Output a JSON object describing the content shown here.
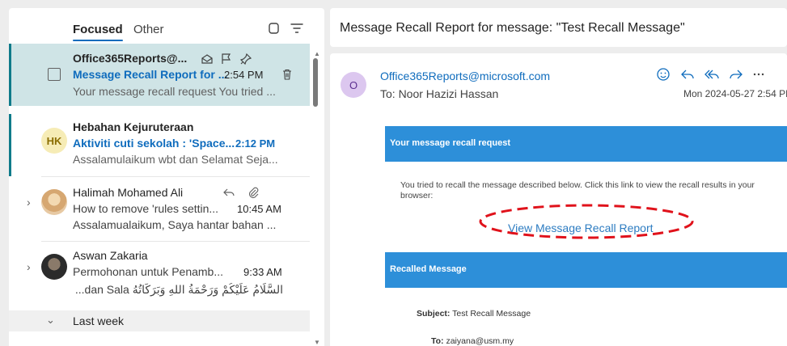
{
  "tabs": {
    "focused": "Focused",
    "other": "Other"
  },
  "mails": [
    {
      "sender": "Office365Reports@...",
      "subject": "Message Recall Report for ...",
      "time": "2:54 PM",
      "preview": "Your message recall request You tried ..."
    },
    {
      "initials": "HK",
      "sender": "Hebahan Kejuruteraan",
      "subject": "Aktiviti cuti sekolah : 'Space...",
      "time": "2:12 PM",
      "preview": "Assalamulaikum wbt dan Selamat Seja..."
    },
    {
      "sender": "Halimah Mohamed Ali",
      "subject": "How to remove 'rules settin...",
      "time": "10:45 AM",
      "preview": "Assalamualaikum, Saya hantar bahan ..."
    },
    {
      "sender": "Aswan Zakaria",
      "subject": "Permohonan untuk Penamb...",
      "time": "9:33 AM",
      "preview": "السَّلَامُ عَلَيْكُمْ وَرَحْمَةُ اللهِ وَبَرَكَاتُهُ dan Sala..."
    }
  ],
  "group_header": "Last week",
  "reading": {
    "subject": "Message Recall Report for message: \"Test Recall Message\"",
    "from_initial": "O",
    "from_email": "Office365Reports@microsoft.com",
    "to_line": "To:  Noor Hazizi Hassan",
    "date": "Mon 2024-05-27 2:54 PM",
    "body": {
      "band1": "Your message recall request",
      "text": "You tried to recall the message described below. Click this link to view the recall results in your browser:",
      "link": "View Message Recall Report",
      "band2": "Recalled Message",
      "subject_label": "Subject:",
      "subject_value": "Test Recall Message",
      "to_label": "To:",
      "to_value": "zaiyana@usm.my"
    }
  },
  "colors": {
    "accent": "#0f6cbd",
    "band": "#2d8fd9",
    "highlight": "#cfe4e6",
    "annotation": "#e0121b"
  },
  "icons": [
    "select-all-icon",
    "filter-icon",
    "open-envelope-icon",
    "flag-icon",
    "pin-icon",
    "trash-icon",
    "reply-icon",
    "attachment-icon",
    "emoji-icon",
    "reply-all-icon",
    "forward-icon",
    "more-icon"
  ]
}
